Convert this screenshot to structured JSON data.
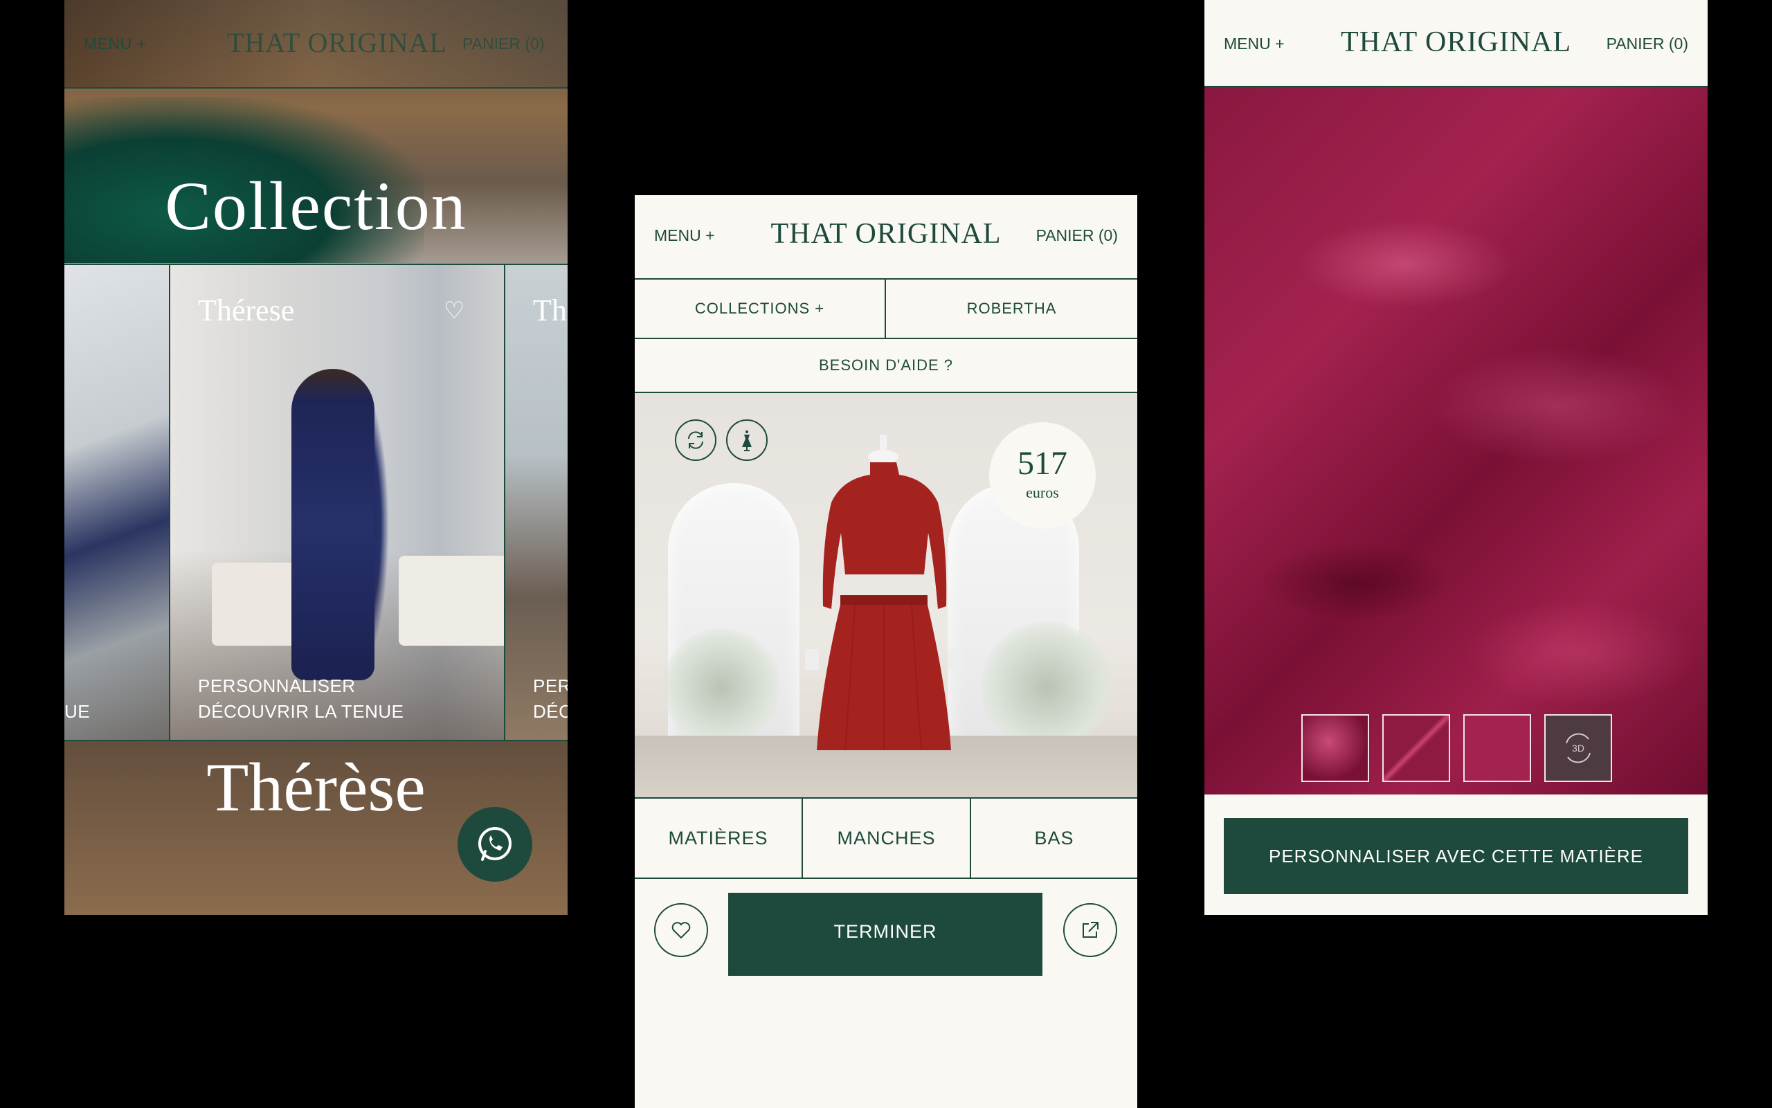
{
  "brand": {
    "logo": "THAT ORIGINAL",
    "color_primary": "#1d4a3c",
    "color_background": "#faf8f2"
  },
  "nav": {
    "menu_label": "MENU +",
    "cart_label": "PANIER (0)",
    "cart_label_partial": "PANIER (0)"
  },
  "left": {
    "collection_title": "Collection",
    "cards": [
      {
        "name": "",
        "link1": "",
        "link2": "UE"
      },
      {
        "name": "Thérese",
        "link1": "PERSONNALISER",
        "link2": "DÉCOUVRIR LA TENUE"
      },
      {
        "name": "Th",
        "link1": "PER",
        "link2": "DÉC"
      }
    ],
    "bottom_title": "Thérèse",
    "whatsapp_icon": "whatsapp-icon"
  },
  "middle": {
    "collections_label": "COLLECTIONS +",
    "model_label": "ROBERTHA",
    "help_label": "BESOIN D'AIDE ?",
    "price_value": "517",
    "price_unit": "euros",
    "dress_color": "#a5231f",
    "tabs": [
      "MATIÈRES",
      "MANCHES",
      "BAS"
    ],
    "finish_label": "TERMINER"
  },
  "right": {
    "fabric_color": "#8a1840",
    "swatches": [
      "satin-drape",
      "satin-diagonal",
      "satin-flat",
      "3d-view"
    ],
    "swatch_3d_label": "3D",
    "cta_label": "PERSONNALISER AVEC CETTE MATIÈRE"
  }
}
